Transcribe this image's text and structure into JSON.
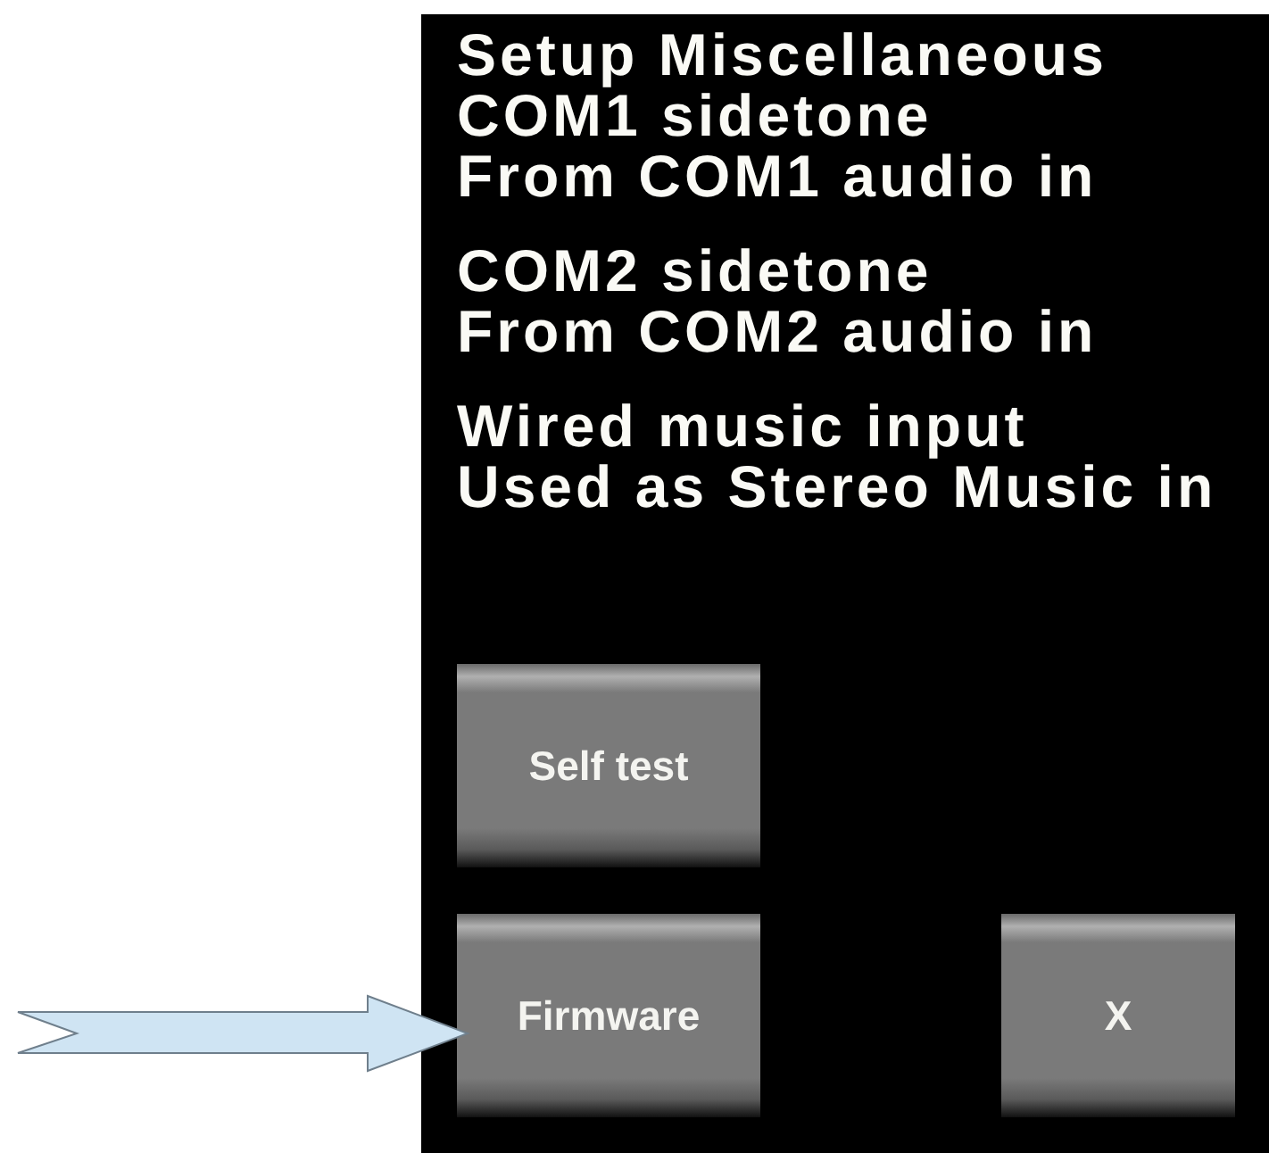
{
  "title": "Setup Miscellaneous",
  "settings": [
    {
      "label": "COM1 sidetone",
      "value": "From COM1 audio in"
    },
    {
      "label": "COM2 sidetone",
      "value": "From COM2 audio in"
    },
    {
      "label": "Wired music input",
      "value": "Used as Stereo Music in"
    }
  ],
  "button_rows": [
    {
      "buttons": [
        {
          "label": "Self test",
          "kind": "wide"
        }
      ]
    },
    {
      "buttons": [
        {
          "label": "Firmware",
          "kind": "wide"
        },
        {
          "label": "X",
          "kind": "narrow"
        }
      ]
    }
  ]
}
